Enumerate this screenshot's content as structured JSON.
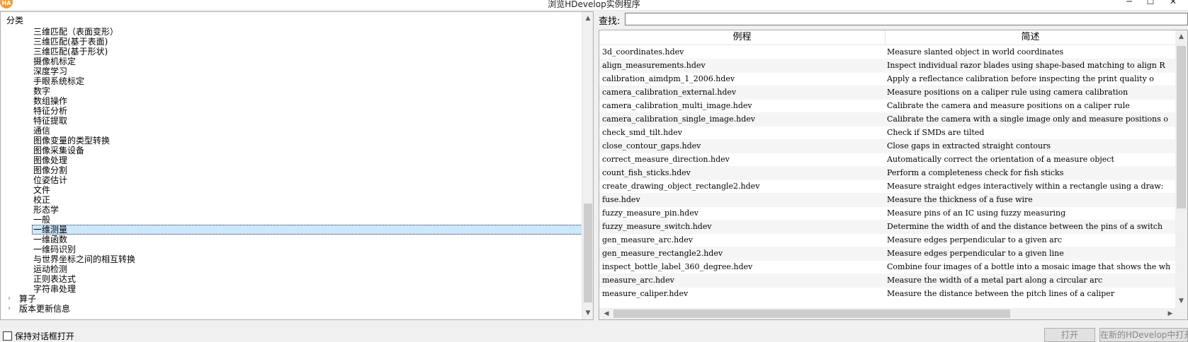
{
  "window": {
    "title": "浏览HDevelop实例程序",
    "logo_text": "HA",
    "minimize": "─",
    "maximize": "☐",
    "close": "✕"
  },
  "tree": {
    "root_label": "分类",
    "items": [
      "三维匹配（表面变形）",
      "三维匹配(基于表面)",
      "三维匹配(基于形状)",
      "摄像机标定",
      "深度学习",
      "手眼系统标定",
      "数字",
      "数组操作",
      "特征分析",
      "特征提取",
      "通信",
      "图像变量的类型转换",
      "图像采集设备",
      "图像处理",
      "图像分割",
      "位姿估计",
      "文件",
      "校正",
      "形态学",
      "一般",
      "一维测量",
      "一维函数",
      "一维码识别",
      "与世界坐标之间的相互转换",
      "运动检测",
      "正则表达式",
      "字符串处理"
    ],
    "selected_index": 20,
    "top_items": [
      "算子",
      "版本更新信息"
    ]
  },
  "search": {
    "label": "查找:",
    "value": ""
  },
  "table": {
    "headers": [
      "例程",
      "简述"
    ],
    "rows": [
      [
        "3d_coordinates.hdev",
        "Measure slanted object in world coordinates"
      ],
      [
        "align_measurements.hdev",
        "Inspect individual razor blades using shape-based matching to align R"
      ],
      [
        "calibration_aimdpm_1_2006.hdev",
        "Apply a reflectance calibration before inspecting the print quality o"
      ],
      [
        "camera_calibration_external.hdev",
        "Measure positions on a caliper rule using camera calibration"
      ],
      [
        "camera_calibration_multi_image.hdev",
        "Calibrate the camera and measure positions on a caliper rule"
      ],
      [
        "camera_calibration_single_image.hdev",
        "Calibrate the camera with a single image only and measure positions o"
      ],
      [
        "check_smd_tilt.hdev",
        "Check if SMDs are tilted"
      ],
      [
        "close_contour_gaps.hdev",
        "Close gaps in extracted straight contours"
      ],
      [
        "correct_measure_direction.hdev",
        "Automatically correct the orientation of a measure object"
      ],
      [
        "count_fish_sticks.hdev",
        "Perform a completeness check for fish sticks"
      ],
      [
        "create_drawing_object_rectangle2.hdev",
        "Measure straight edges interactively within a rectangle using a draw:"
      ],
      [
        "fuse.hdev",
        "Measure the thickness of a fuse wire"
      ],
      [
        "fuzzy_measure_pin.hdev",
        "Measure pins of an IC using fuzzy measuring"
      ],
      [
        "fuzzy_measure_switch.hdev",
        "Determine the width of and the distance between the pins of a switch"
      ],
      [
        "gen_measure_arc.hdev",
        "Measure edges perpendicular to a given arc"
      ],
      [
        "gen_measure_rectangle2.hdev",
        "Measure edges perpendicular to a given line"
      ],
      [
        "inspect_bottle_label_360_degree.hdev",
        "Combine four images of a bottle into a mosaic image that shows the wh"
      ],
      [
        "measure_arc.hdev",
        "Measure the width of a metal part along a circular arc"
      ],
      [
        "measure_caliper.hdev",
        "Measure the distance between the pitch lines of a caliper"
      ]
    ]
  },
  "footer": {
    "keep_open_label": "保持对话框打开",
    "keep_open_checked": false,
    "open_button": "打开",
    "open_new_button": "在新的HDevelop中打开"
  }
}
